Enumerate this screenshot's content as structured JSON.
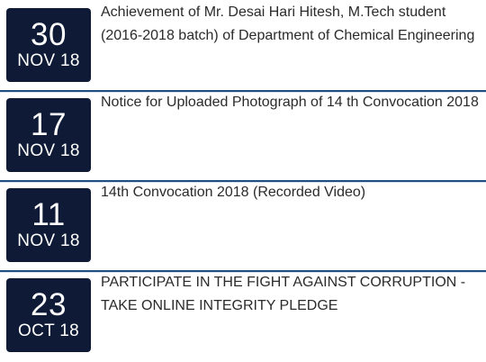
{
  "news": [
    {
      "day": "30",
      "month_year": "NOV 18",
      "title": "Achievement of Mr. Desai Hari Hitesh, M.Tech student (2016-2018 batch) of Department of Chemical Engineering"
    },
    {
      "day": "17",
      "month_year": "NOV 18",
      "title": "Notice for Uploaded Photograph of 14 th Convocation 2018"
    },
    {
      "day": "11",
      "month_year": "NOV 18",
      "title": "14th Convocation 2018 (Recorded Video)"
    },
    {
      "day": "23",
      "month_year": "OCT 18",
      "title": "PARTICIPATE IN THE FIGHT AGAINST CORRUPTION - TAKE ONLINE INTEGRITY PLEDGE"
    }
  ],
  "colors": {
    "badge_background": "#0f1b36",
    "divider": "#1f4f82",
    "title_text": "#2b2b2b"
  }
}
